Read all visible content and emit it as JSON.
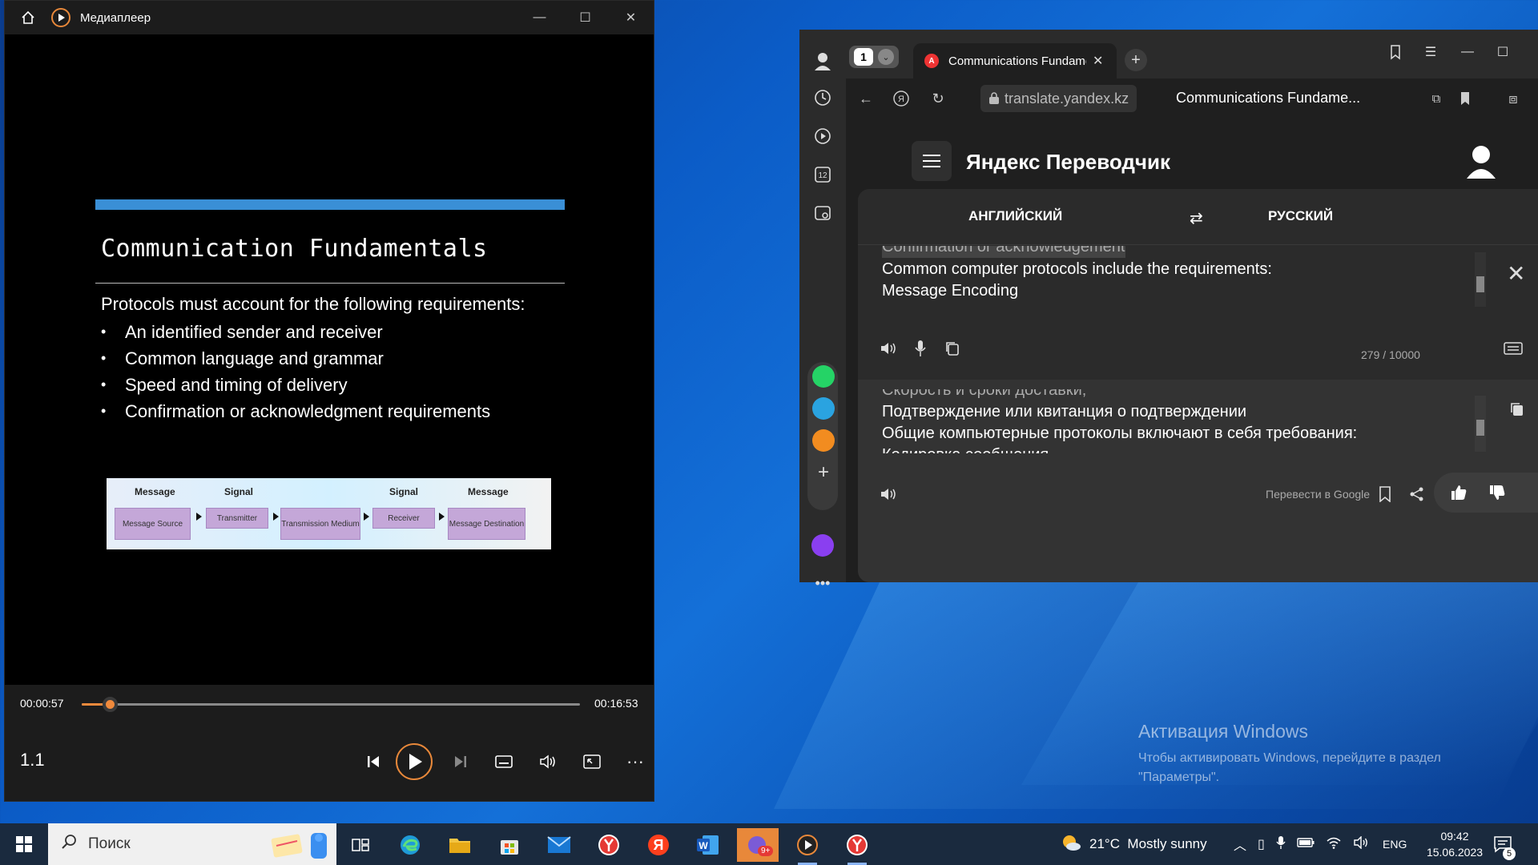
{
  "player": {
    "title": "Медиаплеер",
    "slide": {
      "title": "Communication Fundamentals",
      "intro": "Protocols must account for the following requirements:",
      "bullets": [
        "An identified sender and receiver",
        "Common language and grammar",
        "Speed and timing of delivery",
        "Confirmation or acknowledgment requirements"
      ],
      "diagram": {
        "labels": [
          "Message",
          "Signal",
          "Signal",
          "Message"
        ],
        "boxes": [
          "Message Source",
          "Transmitter",
          "Transmission Medium",
          "Receiver",
          "Message Destination"
        ]
      }
    },
    "current_time": "00:00:57",
    "total_time": "00:16:53",
    "progress": 0.056,
    "speed": "1.1"
  },
  "browser": {
    "tab_count": "1",
    "tab_title": "Communications Fundamentals",
    "domain": "translate.yandex.kz",
    "page_title": "Communications Fundame...",
    "translator": {
      "logo": "Яндекс Переводчик",
      "source_lang": "АНГЛИЙСКИЙ",
      "target_lang": "РУССКИЙ",
      "source_lines": [
        "Confirmation or acknowledgement",
        "Common computer protocols include the requirements:",
        "Message Encoding"
      ],
      "char_count": "279 / 10000",
      "target_lines": [
        "Скорость и сроки доставки;",
        "Подтверждение или квитанция о подтверждении",
        "Общие компьютерные протоколы включают в себя требования:",
        "Кодировка сообщения"
      ],
      "google_link": "Перевести в Google"
    }
  },
  "desktop": {
    "activation_title": "Активация Windows",
    "activation_line1": "Чтобы активировать Windows, перейдите в раздел",
    "activation_line2": "\"Параметры\"."
  },
  "taskbar": {
    "search_placeholder": "Поиск",
    "weather": "21°C  Mostly sunny",
    "lang": "ENG",
    "time": "09:42",
    "date": "15.06.2023",
    "notification_count": "5",
    "badge": "9+"
  },
  "colors": {
    "accent_orange": "#f08a3c",
    "slide_bar": "#3a8fd6",
    "diagram_box": "#c4a7d8"
  }
}
